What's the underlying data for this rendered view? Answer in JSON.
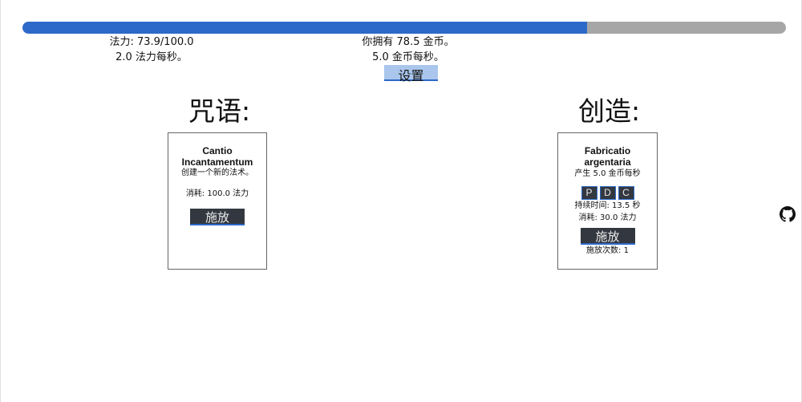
{
  "mana": {
    "current": 73.9,
    "max": 100.0,
    "bar_fraction": 0.739,
    "text": "法力: 73.9/100.0",
    "rate_text": "2.0 法力每秒。"
  },
  "gold": {
    "text": "你拥有 78.5 金币。",
    "rate_text": "5.0 金币每秒。"
  },
  "settings_label": "设置",
  "spells": {
    "heading": "咒语:",
    "items": [
      {
        "title": "Cantio Incantamentum",
        "desc": "创建一个新的法术。",
        "cost": "消耗: 100.0 法力",
        "cast_label": "施放"
      }
    ]
  },
  "crafting": {
    "heading": "创造:",
    "items": [
      {
        "title": "Fabricatio argentaria",
        "produce": "产生 5.0 金币每秒",
        "runes": [
          "P",
          "D",
          "C"
        ],
        "duration": "持续时间: 13.5 秒",
        "cost": "消耗: 30.0 法力",
        "cast_label": "施放",
        "cast_count": "施放次数: 1"
      }
    ]
  },
  "colors": {
    "accent": "#2d69c8",
    "track": "#a6a6a6",
    "button_dark": "#333840",
    "button_light": "#aac6ec"
  },
  "icons": {
    "footer": "github-icon"
  }
}
